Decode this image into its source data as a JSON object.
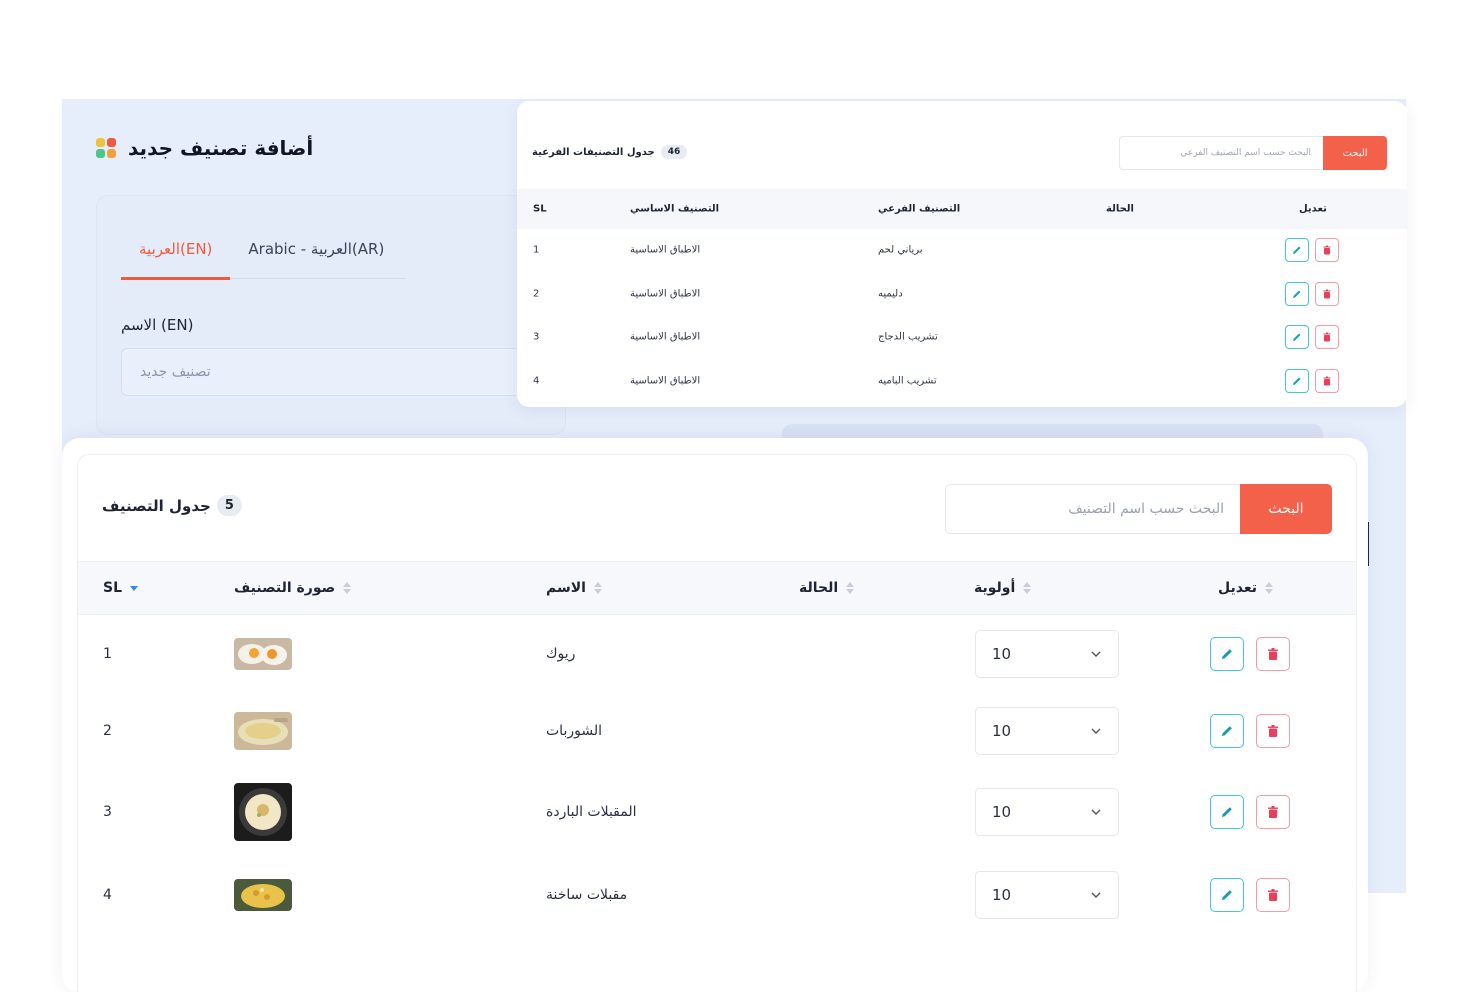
{
  "colors": {
    "accent": "#f3614a",
    "toggle_on": "#f05a4e",
    "edit": "#43c7d6",
    "delete": "#e8405a",
    "panel_bg": "#e6eefb"
  },
  "add_category": {
    "title": "أضافة تصنيف جديد",
    "tabs": [
      {
        "label": "العربية(EN)",
        "active": true
      },
      {
        "label": "Arabic - العربية(AR)",
        "active": false
      }
    ],
    "name_label": "الاسم (EN)",
    "name_placeholder": "تصنيف جديد"
  },
  "sub_table": {
    "title": "جدول التصنيفات الفرعية",
    "count": "46",
    "search_placeholder": "البحث حسب اسم التصنيف الفرعي",
    "search_button": "البحث",
    "headers": {
      "sl": "SL",
      "main": "التصنيف الاساسي",
      "sub": "التصنيف الفرعي",
      "status": "الحالة",
      "edit": "تعديل"
    },
    "rows": [
      {
        "sl": "1",
        "main": "الاطباق الاساسية",
        "sub": "برياني لحم",
        "status_on": true
      },
      {
        "sl": "2",
        "main": "الاطباق الاساسية",
        "sub": "دليميه",
        "status_on": true
      },
      {
        "sl": "3",
        "main": "الاطباق الاساسية",
        "sub": "تشريب الدجاج",
        "status_on": true
      },
      {
        "sl": "4",
        "main": "الاطباق الاساسية",
        "sub": "تشريب الباميه",
        "status_on": true
      }
    ]
  },
  "main_table": {
    "title": "جدول التصنيف",
    "count": "5",
    "search_placeholder": "البحث حسب اسم التصنيف",
    "search_button": "البحث",
    "headers": {
      "sl": "SL",
      "image": "صورة التصنيف",
      "name": "الاسم",
      "status": "الحالة",
      "priority": "أولوية",
      "edit": "تعديل"
    },
    "rows": [
      {
        "sl": "1",
        "name": "ريوك",
        "status_on": true,
        "priority": "10",
        "image": "eggs-image"
      },
      {
        "sl": "2",
        "name": "الشوربات",
        "status_on": true,
        "priority": "10",
        "image": "soup-image"
      },
      {
        "sl": "3",
        "name": "المقبلات الباردة",
        "status_on": true,
        "priority": "10",
        "image": "hummus-image"
      },
      {
        "sl": "4",
        "name": "مقبلات ساخنة",
        "status_on": true,
        "priority": "10",
        "image": "hot-appetizer-image"
      }
    ]
  }
}
